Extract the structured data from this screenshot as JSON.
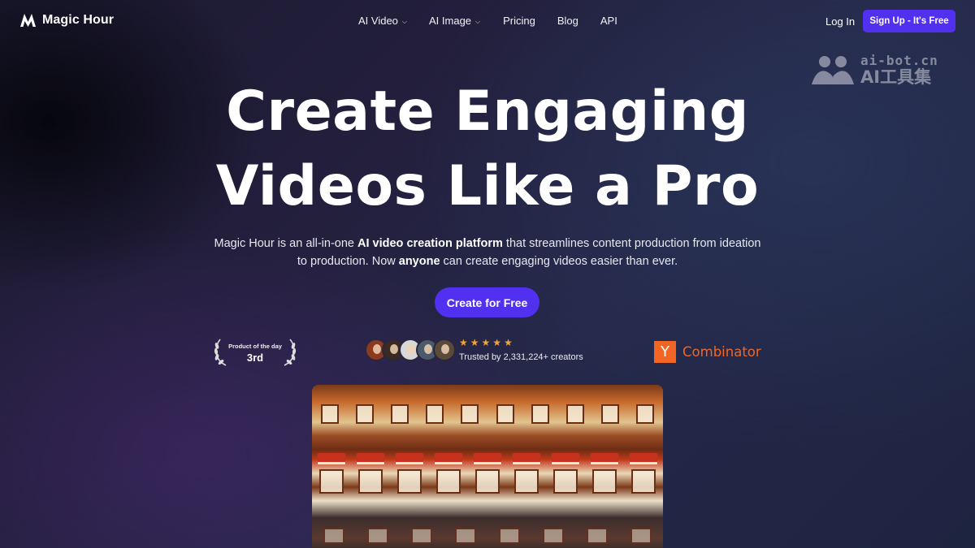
{
  "brand": {
    "name": "Magic Hour"
  },
  "nav": {
    "items": [
      {
        "label": "AI Video",
        "dropdown": true
      },
      {
        "label": "AI Image",
        "dropdown": true
      },
      {
        "label": "Pricing",
        "dropdown": false
      },
      {
        "label": "Blog",
        "dropdown": false
      },
      {
        "label": "API",
        "dropdown": false
      }
    ],
    "login_label": "Log In",
    "signup_label": "Sign Up - It's Free"
  },
  "watermark": {
    "url": "ai-bot.cn",
    "name": "AI工具集"
  },
  "hero": {
    "headline_line1": "Create Engaging",
    "headline_line2": "Videos Like a Pro",
    "subtitle": {
      "part1": "Magic Hour is an all-in-one ",
      "bold1": "AI video creation platform",
      "part2": " that streamlines content production from ideation to production. Now ",
      "bold2": "anyone",
      "part3": " can create engaging videos easier than ever."
    },
    "cta_label": "Create for Free"
  },
  "badges": {
    "product_hunt": {
      "title": "Product of the day",
      "rank": "3rd"
    },
    "rating": {
      "stars": 5,
      "trusted_text": "Trusted by 2,331,224+ creators"
    },
    "yc": {
      "letter": "Y",
      "name": "Combinator"
    }
  },
  "colors": {
    "accent": "#5230f0",
    "star": "#f4a52a",
    "yc": "#f26522"
  },
  "icons": {
    "logo": "magic-hour-logo-icon",
    "dropdown": "chevron-down-icon",
    "star": "star-icon",
    "laurel": "laurel-icon"
  }
}
